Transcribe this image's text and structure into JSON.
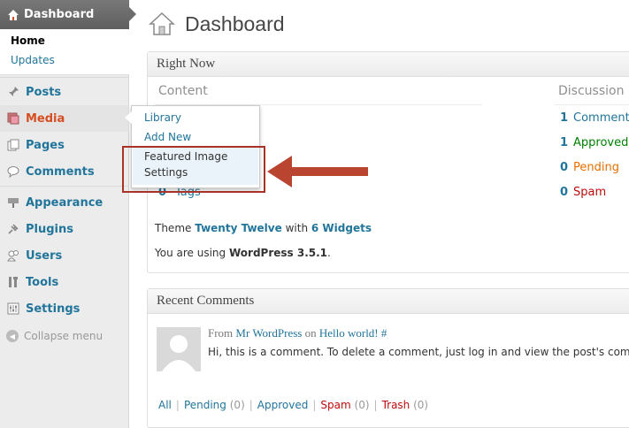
{
  "sidebar": {
    "dashboard_label": "Dashboard",
    "submenu": {
      "home": "Home",
      "updates": "Updates"
    },
    "items": [
      {
        "label": "Posts",
        "icon": "pin-icon"
      },
      {
        "label": "Media",
        "icon": "media-icon"
      },
      {
        "label": "Pages",
        "icon": "pages-icon"
      },
      {
        "label": "Comments",
        "icon": "comment-icon"
      },
      {
        "label": "Appearance",
        "icon": "paintbrush-icon"
      },
      {
        "label": "Plugins",
        "icon": "plug-icon"
      },
      {
        "label": "Users",
        "icon": "users-icon"
      },
      {
        "label": "Tools",
        "icon": "tools-icon"
      },
      {
        "label": "Settings",
        "icon": "settings-icon"
      }
    ],
    "collapse_label": "Collapse menu"
  },
  "flyout": {
    "items": [
      "Library",
      "Add New",
      "Featured Image",
      "Settings"
    ]
  },
  "page": {
    "title": "Dashboard"
  },
  "right_now": {
    "title": "Right Now",
    "content_header": "Content",
    "discussion_header": "Discussion",
    "content_rows": [
      {
        "count": "0",
        "label": "Tags"
      }
    ],
    "discussion_rows": [
      {
        "count": "1",
        "label": "Comment",
        "color": "#21759b"
      },
      {
        "count": "1",
        "label": "Approved",
        "color": "#008000"
      },
      {
        "count": "0",
        "label": "Pending",
        "color": "#e66f00"
      },
      {
        "count": "0",
        "label": "Spam",
        "color": "#bc0b0b"
      }
    ],
    "theme_prefix": "Theme",
    "theme_name": "Twenty Twelve",
    "theme_with": "with",
    "widgets": "6 Widgets",
    "using_prefix": "You are using",
    "wp_version": "WordPress 3.5.1",
    "using_suffix": "."
  },
  "recent_comments": {
    "title": "Recent Comments",
    "from": "From",
    "author": "Mr WordPress",
    "on": "on",
    "post": "Hello world!",
    "hash": "#",
    "excerpt": "Hi, this is a comment. To delete a comment, just log in and view the post's comm",
    "filters": {
      "all": "All",
      "pending": "Pending",
      "pending_count": "(0)",
      "approved": "Approved",
      "spam": "Spam",
      "spam_count": "(0)",
      "trash": "Trash",
      "trash_count": "(0)"
    }
  },
  "colors": {
    "link": "#21759b",
    "active_menu": "#d54e21",
    "annotation_red": "#a93226"
  }
}
